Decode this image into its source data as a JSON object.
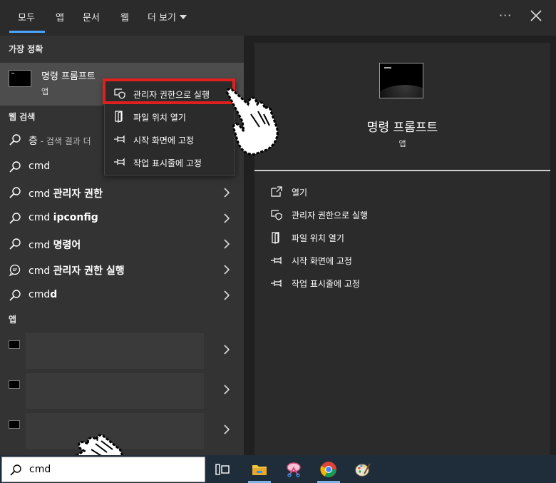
{
  "tabs": [
    {
      "label": "모두",
      "active": true
    },
    {
      "label": "앱"
    },
    {
      "label": "문서"
    },
    {
      "label": "웹"
    },
    {
      "label": "더 보기"
    }
  ],
  "header": {
    "more": "···"
  },
  "left": {
    "best_match_label": "가장 정확",
    "best_match": {
      "title": "명령 프롬프트",
      "subtitle": "앱"
    },
    "web_search_label": "웹 검색",
    "web_rows": [
      {
        "text": "층",
        "hint": " - 검색 결과 더",
        "icon": "search-icon"
      },
      {
        "text": "cmd",
        "icon": "search-icon"
      },
      {
        "text": "cmd ",
        "bold": "관리자 권한",
        "icon": "search-icon"
      },
      {
        "text": "cmd ",
        "bold": "ipconfig",
        "icon": "search-icon"
      },
      {
        "text": "cmd ",
        "bold": "명령어",
        "icon": "search-icon"
      },
      {
        "text": "cmd ",
        "bold": "관리자 권한 실행",
        "icon": "chat-icon"
      },
      {
        "text": "cmd",
        "bold": "d",
        "icon": "search-icon"
      }
    ],
    "apps_label": "앱"
  },
  "context_menu": [
    {
      "label": "관리자 권한으로 실행",
      "icon": "shield-icon"
    },
    {
      "label": "파일 위치 열기",
      "icon": "folder-icon"
    },
    {
      "label": "시작 화면에 고정",
      "icon": "pin-icon"
    },
    {
      "label": "작업 표시줄에 고정",
      "icon": "pin-icon"
    }
  ],
  "right": {
    "title": "명령 프롬프트",
    "subtitle": "앱",
    "actions": [
      {
        "label": "열기",
        "icon": "open-icon"
      },
      {
        "label": "관리자 권한으로 실행",
        "icon": "shield-icon"
      },
      {
        "label": "파일 위치 열기",
        "icon": "folder-icon"
      },
      {
        "label": "시작 화면에 고정",
        "icon": "pin-icon"
      },
      {
        "label": "작업 표시줄에 고정",
        "icon": "pin-icon"
      }
    ]
  },
  "taskbar": {
    "search_value": "cmd",
    "icons": [
      "task-view-icon",
      "file-explorer-icon",
      "snipping-tool-icon",
      "chrome-icon",
      "paint-icon"
    ]
  },
  "colors": {
    "accent": "#4aa3ff",
    "highlight": "#e0201e",
    "taskbar": "#1f2d3a"
  }
}
